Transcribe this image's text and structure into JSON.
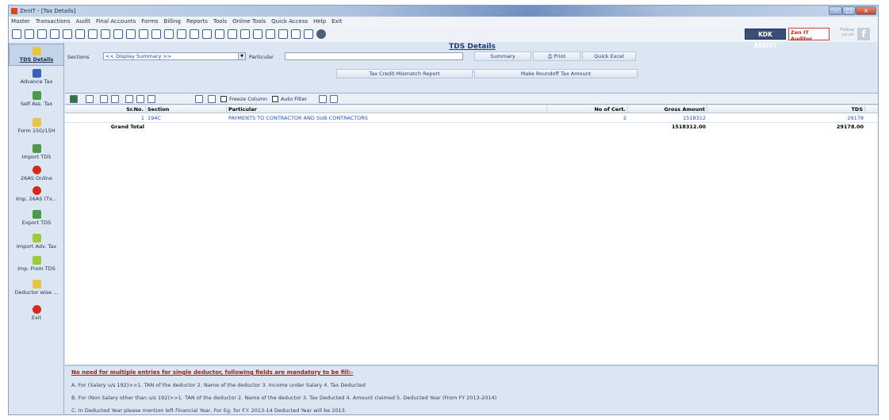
{
  "window": {
    "title": "ZenIT - [Tax Details]"
  },
  "menu": [
    "Master",
    "Transactions",
    "Audit",
    "Final Accounts",
    "Forms",
    "Billing",
    "Reports",
    "Tools",
    "Online Tools",
    "Quick Access",
    "Help",
    "Exit"
  ],
  "toolbar": {
    "kdk_assist": "KDK ASSIST",
    "zen_it_auditor": "Zen IT Auditor",
    "follow_us": "Follow us on",
    "fb": "f"
  },
  "sidebar": {
    "items": [
      {
        "label": "TDS Details",
        "icon": "pencil-icon"
      },
      {
        "label": "Advance Tax",
        "icon": "advance-tax-icon"
      },
      {
        "label": "Self Ass. Tax",
        "icon": "self-assessment-icon"
      },
      {
        "label": "Form 15G/15H",
        "icon": "pencil-icon"
      },
      {
        "label": "Import TDS",
        "icon": "excel-icon"
      },
      {
        "label": "26AS Online",
        "icon": "online-e-icon"
      },
      {
        "label": "Imp. 26AS (Tx...",
        "icon": "online-e-icon"
      },
      {
        "label": "Export TDS",
        "icon": "excel-icon"
      },
      {
        "label": "Import Adv. Tax",
        "icon": "import-arrow-icon"
      },
      {
        "label": "Imp. From TDS",
        "icon": "import-arrow-icon"
      },
      {
        "label": "Deductor wise ...",
        "icon": "pencil-icon"
      },
      {
        "label": "Exit",
        "icon": "exit-icon"
      }
    ]
  },
  "page": {
    "title": "TDS Details",
    "sections_label": "Sections",
    "sections_value": "<< Display Summary >>",
    "particular_label": "Particular",
    "buttons": {
      "summary": "Summary",
      "print": "Print",
      "quick_excel": "Quick Excel",
      "mismatch": "Tax Credit Mismatch Report",
      "roundoff": "Make Roundoff Tax Amount"
    },
    "freeze_column": "Freeze Column",
    "auto_filter": "Auto Filter"
  },
  "grid": {
    "columns": [
      "Sr.No.",
      "Section",
      "Particular",
      "No of Cert.",
      "Gross Amount",
      "TDS"
    ],
    "rows": [
      [
        "1",
        "194C",
        "PAYMENTS TO CONTRACTOR AND SUB-CONTRACTORS",
        "2",
        "1518312",
        "29178"
      ]
    ],
    "total": {
      "label": "Grand Total",
      "gross": "1518312.00",
      "tds": "29178.00"
    }
  },
  "notes": {
    "heading": "No need for multiple entries for single deductor, following fields are mandatory to be fill:-",
    "a": "A. For (Salary u/s 192)>>1. TAN of the deductor 2. Name of the deductor 3. Income under Salary 4. Tax Deducted",
    "b": "B. For (Non Salary other than u/s 192)>>1. TAN of the deductor 2. Name of the deductor 3. Tax Deducted 4. Amount claimed 5. Deducted Year (From FY 2013-2014)",
    "c": "C. In Deducted Year please mention left Financial Year, For Eg. for F.Y. 2013-14 Deducted Year will be 2013."
  },
  "colors": {
    "accent": "#1f3c78",
    "link": "#2050c0",
    "note_heading": "#a01e14"
  }
}
